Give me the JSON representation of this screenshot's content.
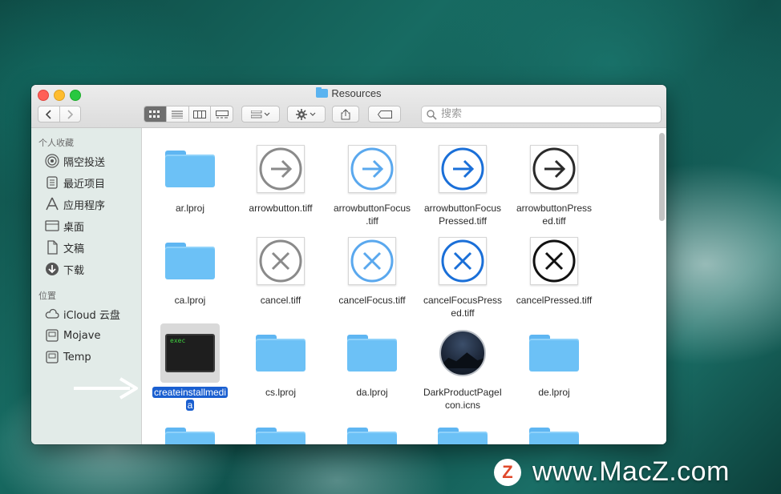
{
  "window": {
    "title": "Resources"
  },
  "search": {
    "placeholder": "搜索"
  },
  "sidebar": {
    "sections": [
      {
        "heading": "个人收藏",
        "items": [
          {
            "label": "隔空投送",
            "icon": "airdrop-icon"
          },
          {
            "label": "最近项目",
            "icon": "recents-icon"
          },
          {
            "label": "应用程序",
            "icon": "applications-icon"
          },
          {
            "label": "桌面",
            "icon": "desktop-icon"
          },
          {
            "label": "文稿",
            "icon": "documents-icon"
          },
          {
            "label": "下载",
            "icon": "downloads-icon"
          }
        ]
      },
      {
        "heading": "位置",
        "items": [
          {
            "label": "iCloud 云盘",
            "icon": "icloud-icon"
          },
          {
            "label": "Mojave",
            "icon": "disk-icon"
          },
          {
            "label": "Temp",
            "icon": "disk-icon"
          }
        ]
      }
    ]
  },
  "files": [
    {
      "name": "ar.lproj",
      "kind": "folder"
    },
    {
      "name": "arrowbutton.tiff",
      "kind": "arrow-gray"
    },
    {
      "name": "arrowbuttonFocus.tiff",
      "kind": "arrow-lightblue"
    },
    {
      "name": "arrowbuttonFocusPressed.tiff",
      "kind": "arrow-blue"
    },
    {
      "name": "arrowbuttonPressed.tiff",
      "kind": "arrow-black"
    },
    {
      "name": "ca.lproj",
      "kind": "folder"
    },
    {
      "name": "cancel.tiff",
      "kind": "cancel-gray"
    },
    {
      "name": "cancelFocus.tiff",
      "kind": "cancel-lightblue"
    },
    {
      "name": "cancelFocusPressed.tiff",
      "kind": "cancel-blue"
    },
    {
      "name": "cancelPressed.tiff",
      "kind": "cancel-black"
    },
    {
      "name": "createinstallmedia",
      "kind": "exec",
      "selected": true
    },
    {
      "name": "cs.lproj",
      "kind": "folder"
    },
    {
      "name": "da.lproj",
      "kind": "folder"
    },
    {
      "name": "DarkProductPageIcon.icns",
      "kind": "icns"
    },
    {
      "name": "de.lproj",
      "kind": "folder"
    }
  ],
  "exec_icon_text": "exec",
  "watermark": {
    "logo": "Z",
    "text": "www.MacZ.com"
  },
  "colors": {
    "selection": "#1a5fd0",
    "folder": "#6cc1f6",
    "sidebar": "#e2ebe8"
  }
}
